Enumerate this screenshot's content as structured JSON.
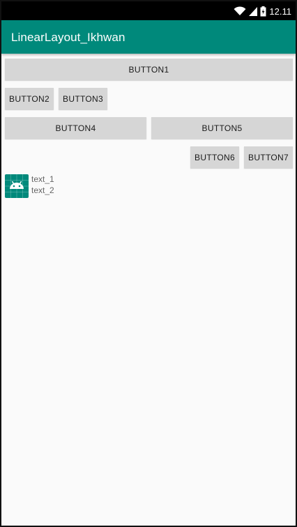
{
  "status_bar": {
    "time": "12.11",
    "icons": [
      "wifi-icon",
      "signal-icon",
      "battery-icon"
    ]
  },
  "app_bar": {
    "title": "LinearLayout_Ikhwan",
    "color": "#00897b"
  },
  "buttons": {
    "button1": "BUTTON1",
    "button2": "BUTTON2",
    "button3": "BUTTON3",
    "button4": "BUTTON4",
    "button5": "BUTTON5",
    "button6": "BUTTON6",
    "button7": "BUTTON7"
  },
  "list_item": {
    "icon": "android-icon",
    "text_1": "text_1",
    "text_2": "text_2"
  }
}
